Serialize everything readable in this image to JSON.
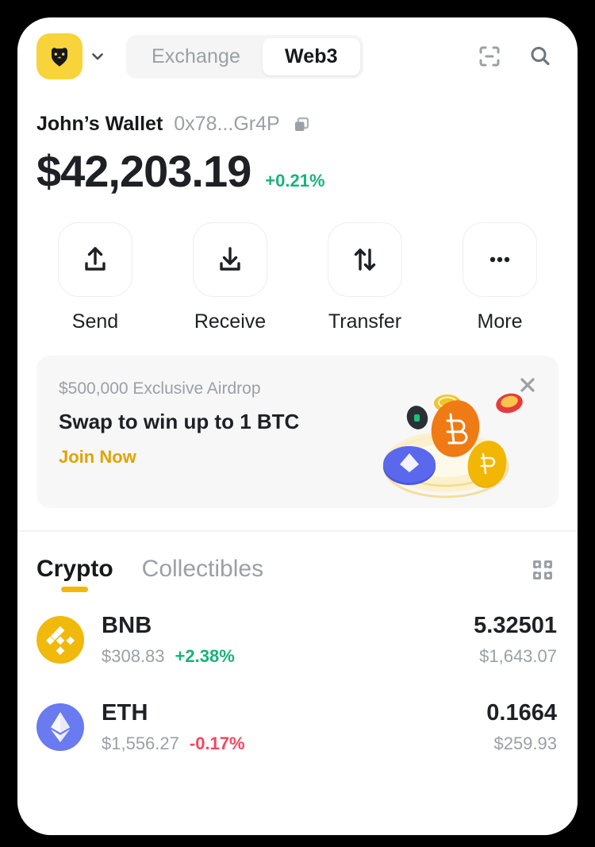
{
  "header": {
    "avatar_icon": "bear-avatar-icon",
    "chevron_icon": "chevron-down-icon",
    "segments": [
      {
        "label": "Exchange",
        "active": false
      },
      {
        "label": "Web3",
        "active": true
      }
    ],
    "scan_icon": "scan-icon",
    "search_icon": "search-icon"
  },
  "wallet": {
    "name": "John’s Wallet",
    "address": "0x78...Gr4P",
    "copy_icon": "copy-icon",
    "balance": "$42,203.19",
    "change": "+0.21%",
    "change_color": "#18B37A"
  },
  "actions": [
    {
      "label": "Send",
      "icon": "upload-arrow-icon"
    },
    {
      "label": "Receive",
      "icon": "download-arrow-icon"
    },
    {
      "label": "Transfer",
      "icon": "transfer-arrows-icon"
    },
    {
      "label": "More",
      "icon": "ellipsis-icon"
    }
  ],
  "banner": {
    "kicker": "$500,000 Exclusive Airdrop",
    "title": "Swap to win up to 1 BTC",
    "cta": "Join Now",
    "cta_color": "#E0A400",
    "close_icon": "close-icon",
    "art_icon": "coins-ring-illustration"
  },
  "tabs": {
    "items": [
      {
        "label": "Crypto",
        "active": true
      },
      {
        "label": "Collectibles",
        "active": false
      }
    ],
    "underline_color": "#F0B90B",
    "manage_icon": "manage-tokens-icon"
  },
  "tokens": [
    {
      "symbol": "BNB",
      "icon": "bnb-icon",
      "price": "$308.83",
      "change": "+2.38%",
      "direction": "up",
      "amount": "5.32501",
      "value": "$1,643.07"
    },
    {
      "symbol": "ETH",
      "icon": "eth-icon",
      "price": "$1,556.27",
      "change": "-0.17%",
      "direction": "down",
      "amount": "0.1664",
      "value": "$259.93"
    }
  ]
}
